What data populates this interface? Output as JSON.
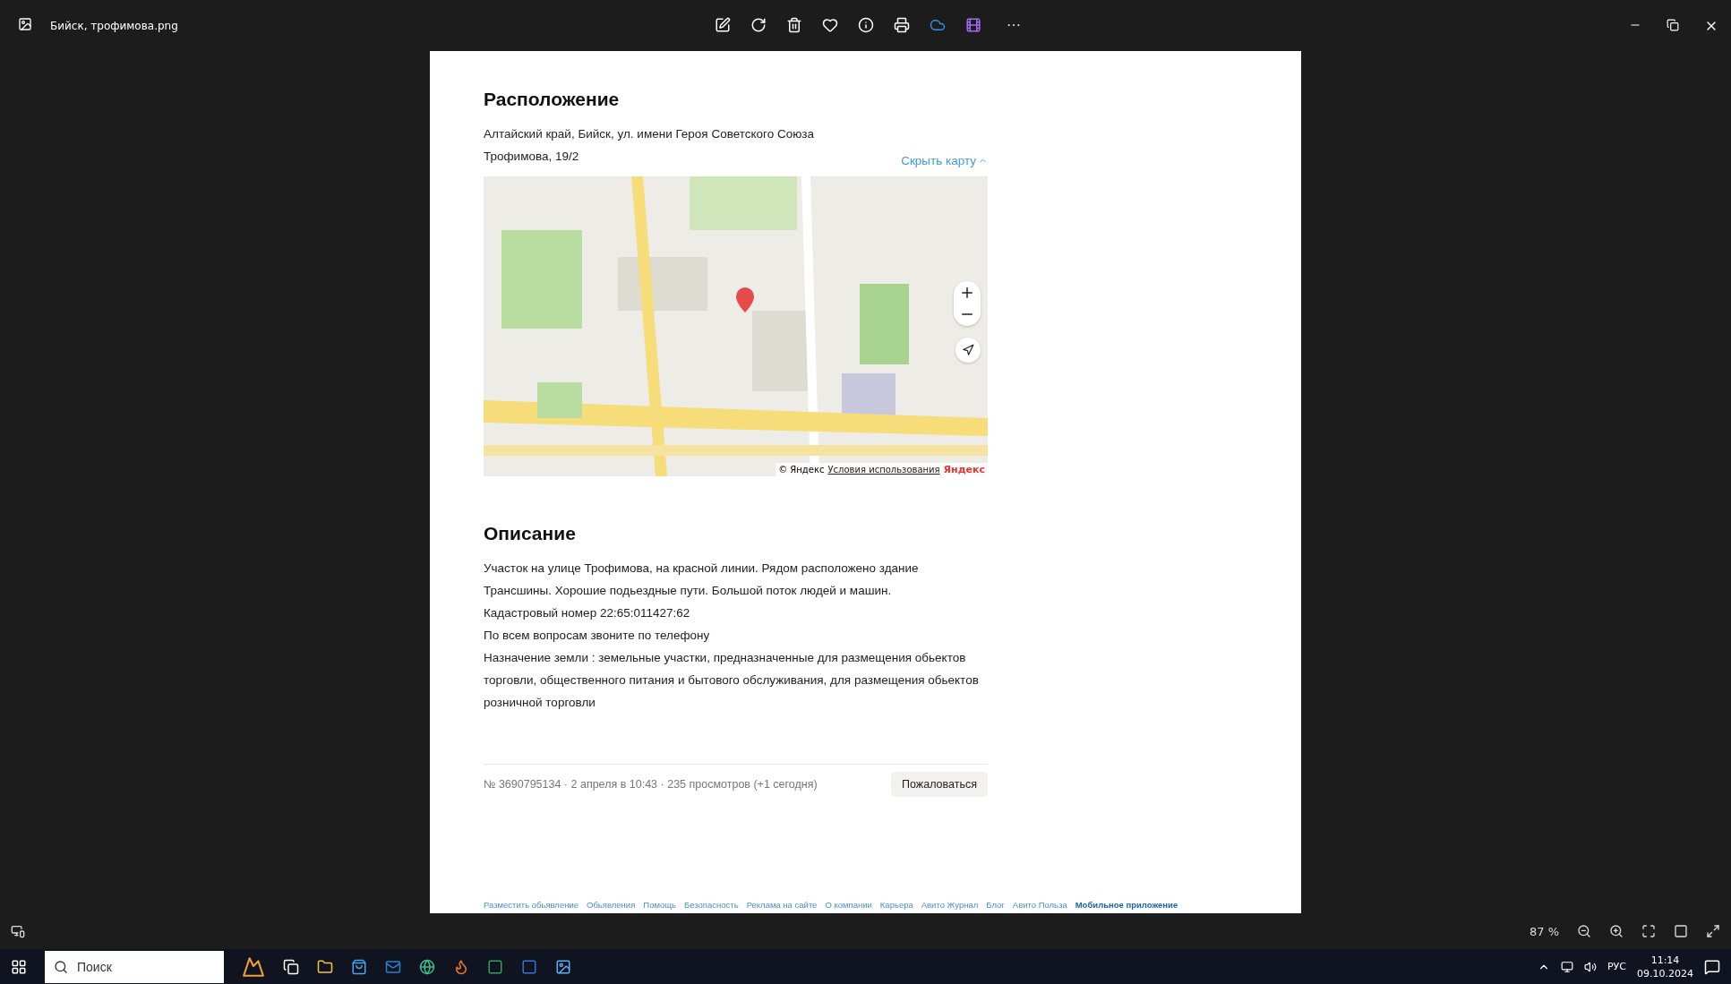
{
  "window": {
    "title": "Бийск, трофимова.png",
    "more": "···"
  },
  "page": {
    "location": {
      "heading": "Расположение",
      "address": "Алтайский край, Бийск, ул. имени Героя Советского Союза Трофимова, 19/2",
      "hide_map": "Скрыть карту",
      "map": {
        "kind": "picture",
        "copyright": "© Яндекс",
        "terms": "Условия использования",
        "brand": "Яндекс"
      }
    },
    "description": {
      "heading": "Описание",
      "lines": [
        "Участок на улице Трофимова, на красной линии. Рядом расположено здание Трансшины. Хорошие подьездные пути. Большой поток людей и машин.",
        "Кадастровый номер 22:65:011427:62",
        "По всем вопросам звоните по телефону",
        "Назначение земли : земельные участки, предназначенные для размещения обьектов торговли, общественного питания и бытового обслуживания, для размещения обьектов розничной торговли"
      ]
    },
    "meta": "№ 3690795134 · 2 апреля в 10:43 · 235 просмотров (+1 сегодня)",
    "report_button": "Пожаловаться",
    "footer_links": [
      {
        "label": "Разместить обьявление",
        "bold": false
      },
      {
        "label": "Обьявления",
        "bold": false
      },
      {
        "label": "Помощь",
        "bold": false
      },
      {
        "label": "Безопасность",
        "bold": false
      },
      {
        "label": "Реклама на сайте",
        "bold": false
      },
      {
        "label": "О компании",
        "bold": false
      },
      {
        "label": "Карьера",
        "bold": false
      },
      {
        "label": "Авито Журнал",
        "bold": false
      },
      {
        "label": "Блог",
        "bold": false
      },
      {
        "label": "Авито Польза",
        "bold": false
      },
      {
        "label": "Мобильное приложение",
        "bold": true
      }
    ]
  },
  "viewer_bar": {
    "zoom": "87 %"
  },
  "taskbar": {
    "search_placeholder": "Поиск",
    "language": "РУС",
    "time": "11:14",
    "date": "09.10.2024"
  }
}
